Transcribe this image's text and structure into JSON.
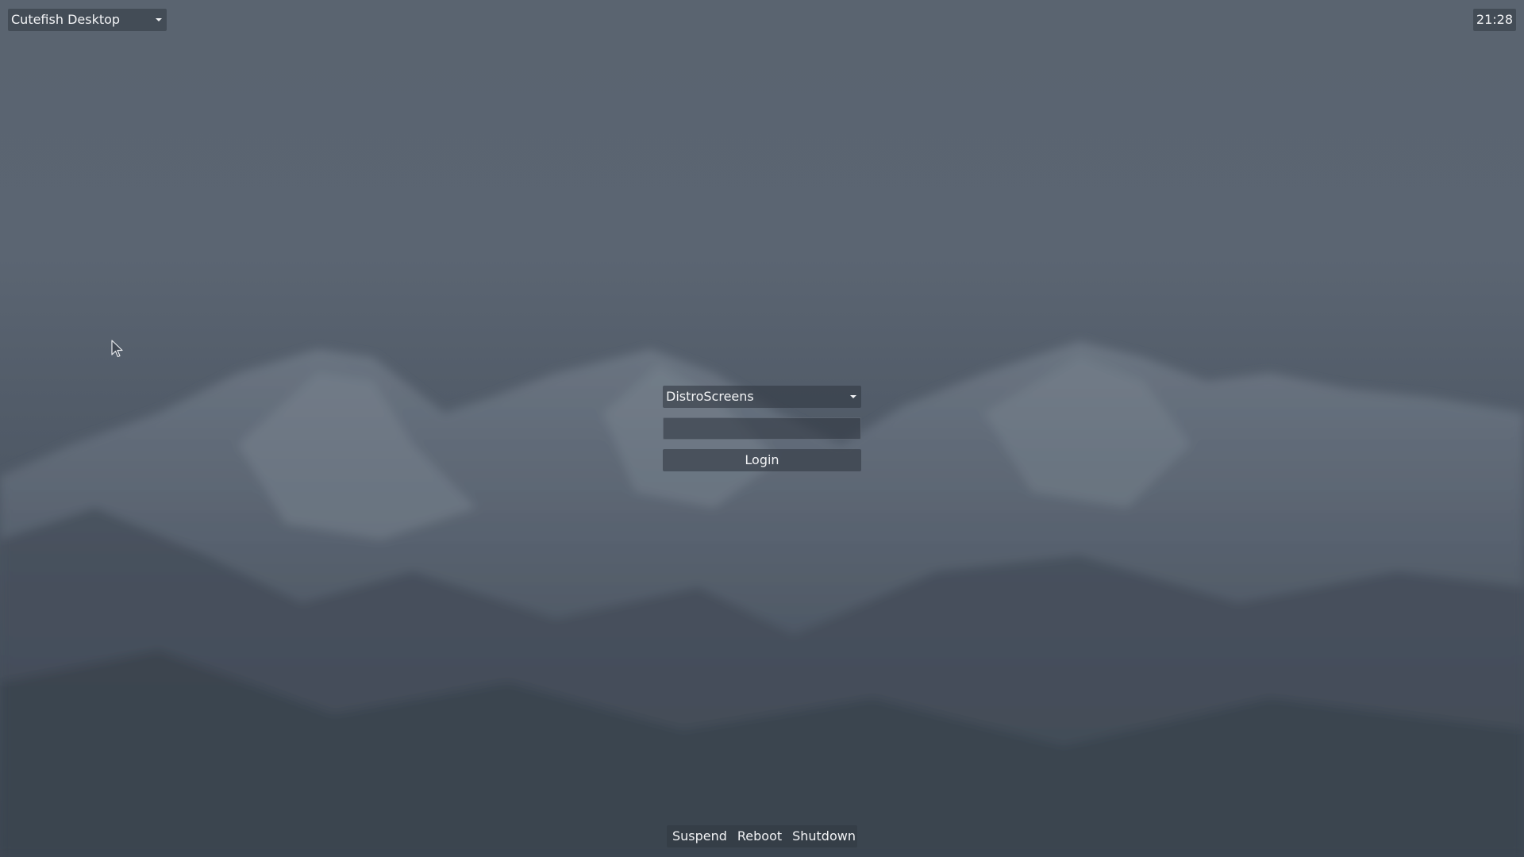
{
  "session": {
    "selected": "Cutefish Desktop"
  },
  "clock": {
    "time": "21:28"
  },
  "login": {
    "user_selected": "DistroScreens",
    "password_value": "",
    "login_label": "Login"
  },
  "power": {
    "suspend_label": "Suspend",
    "reboot_label": "Reboot",
    "shutdown_label": "Shutdown"
  },
  "icons": {
    "cursor": "mouse-pointer-icon",
    "dropdown": "chevron-down-icon"
  }
}
